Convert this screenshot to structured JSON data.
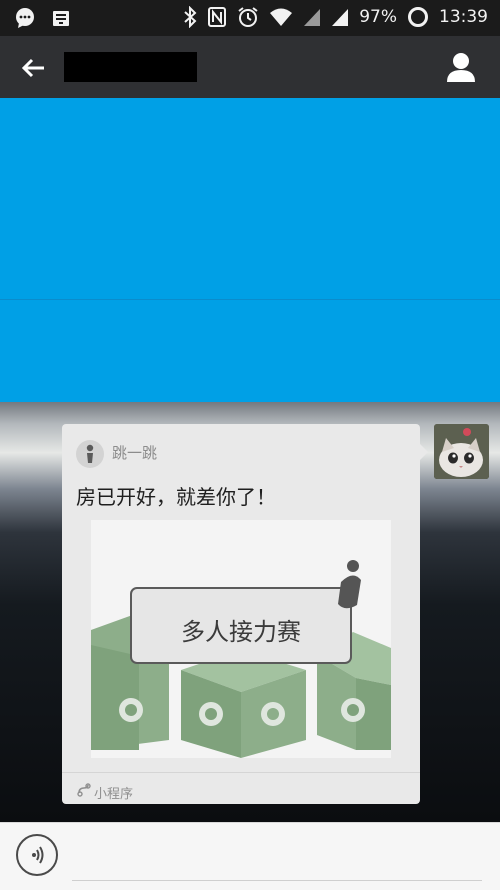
{
  "status_bar": {
    "battery_percent": "97%",
    "time": "13:39",
    "icons": [
      "chat-bubble-icon",
      "download-icon",
      "bluetooth-icon",
      "nfc-icon",
      "alarm-icon",
      "wifi-icon",
      "signal-icon",
      "signal-icon",
      "battery-ring-icon"
    ]
  },
  "nav_bar": {
    "back_icon": "back-arrow-icon",
    "title_redacted": "",
    "profile_icon": "person-icon"
  },
  "chat": {
    "highlight_color": "#00a0e6",
    "card": {
      "app_name": "跳一跳",
      "message": "房已开好，就差你了！",
      "preview_title": "多人接力赛",
      "footer_label": "小程序"
    }
  },
  "input_bar": {
    "voice_icon": "voice-input-icon"
  }
}
